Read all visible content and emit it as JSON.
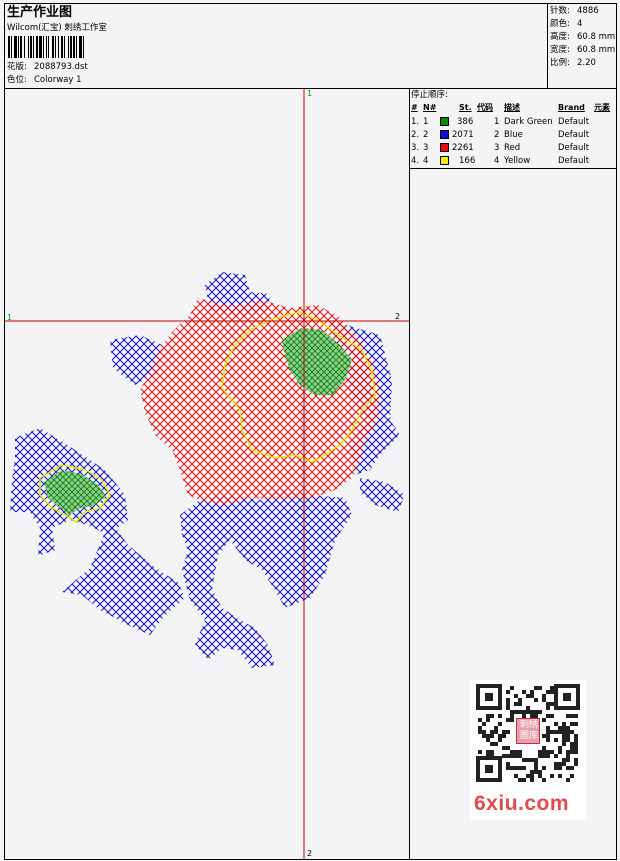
{
  "header": {
    "title": "生产作业图",
    "company": "Wilcom(汇宝) 刺绣工作室",
    "design_label": "花版:",
    "design_value": "2088793.dst",
    "colorway_label": "色位:",
    "colorway_value": "Colorway 1"
  },
  "stats": [
    {
      "label": "针数:",
      "value": "4886"
    },
    {
      "label": "颜色:",
      "value": "4"
    },
    {
      "label": "高度:",
      "value": "60.8 mm"
    },
    {
      "label": "宽度:",
      "value": "60.8 mm"
    },
    {
      "label": "比例:",
      "value": "2.20"
    }
  ],
  "stop_sequence": {
    "title": "停止顺序:",
    "columns": [
      "#",
      "N#",
      "St.",
      "代码",
      "描述",
      "Brand",
      "元素"
    ],
    "rows": [
      {
        "num": "1.",
        "n": "1",
        "st": "386",
        "code": "1",
        "desc": "Dark Green",
        "brand": "Default",
        "color": "#0a8a0a"
      },
      {
        "num": "2.",
        "n": "2",
        "st": "2071",
        "code": "2",
        "desc": "Blue",
        "brand": "Default",
        "color": "#1010d0"
      },
      {
        "num": "3.",
        "n": "3",
        "st": "2261",
        "code": "3",
        "desc": "Red",
        "brand": "Default",
        "color": "#e01010"
      },
      {
        "num": "4.",
        "n": "4",
        "st": "166",
        "code": "4",
        "desc": "Yellow",
        "brand": "Default",
        "color": "#f0f000"
      }
    ]
  },
  "crosshair": {
    "top_label": "1",
    "bottom_label": "2",
    "left_label": "1",
    "right_label": "2",
    "line_color": "#cc0000"
  },
  "watermark": {
    "text": "6xiu.com",
    "seal_text": "刺绣图库"
  },
  "colors": {
    "frame": "#000000",
    "red_stitch": "#e01010",
    "blue_stitch": "#1010c0",
    "green_fill": "#1a9a1a",
    "yellow_outline": "#e8e800"
  }
}
